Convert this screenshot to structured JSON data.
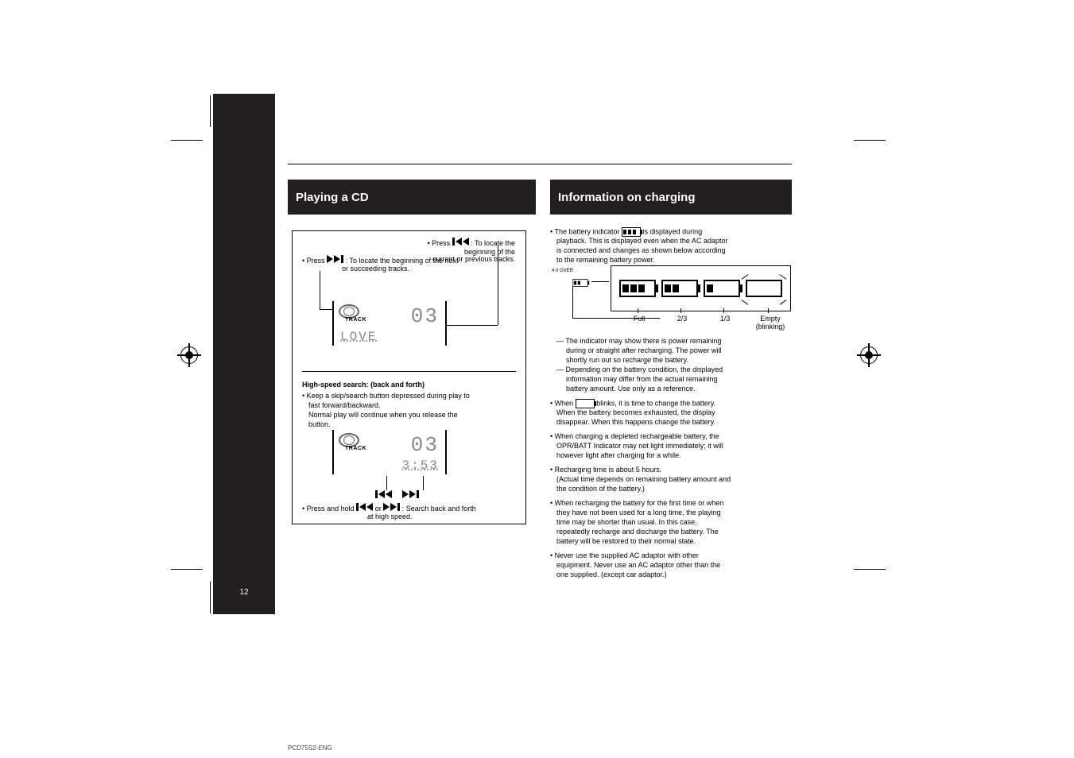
{
  "meta": {
    "page_number": "12",
    "footer_line": "PCD75S2-ENG",
    "track_label": "TRACK",
    "h_over": "4       0 OVER"
  },
  "colors": {
    "gray": [
      "#000000",
      "#1a1a1a",
      "#333333",
      "#4d4d4d",
      "#666666",
      "#808080",
      "#999999",
      "#b3b3b3",
      "#cccccc",
      "#e6e6e6",
      "#ffffff"
    ],
    "cmyk": [
      "#fff200",
      "#ec008c",
      "#00aeef",
      "#2e3192",
      "#ed1c24",
      "#00a651",
      "#231f20",
      "#ffde17",
      "#8dc63f",
      "#6dcff6",
      "#f49ac1"
    ]
  },
  "headings": {
    "left": "Playing a CD",
    "right": "Information on charging"
  },
  "panel": {
    "line1_prefix": "• Press ",
    "line1_suffix": " : To locate the beginning of the next",
    "line1_indent": "or succeeding tracks.",
    "line2_prefix": "• Press ",
    "line2_suffix": " : To locate the beginning of the",
    "line2_indent": "current or previous tracks.",
    "lcd1": {
      "big": "03",
      "sub": "LOVE"
    },
    "sec2_title": "High-speed search: (back and forth)",
    "sec2_l1": "• Keep a skip/search button depressed during play to",
    "sec2_l2": "fast forward/backward.",
    "sec2_l3": "Normal play will continue when you release the",
    "sec2_l4": "button.",
    "lcd2": {
      "big": "03",
      "sub": "3:53"
    },
    "bottom1_prefix": "• Press and hold ",
    "bottom1_mid": " or ",
    "bottom1_suffix": " : Search back and forth",
    "bottom2": "at high speed."
  },
  "right": {
    "intro1_a": "• The battery indicator ",
    "intro1_b": " is displayed during",
    "intro2": "playback. This is displayed even when the AC adaptor",
    "intro3": "is connected and changes as shown below according",
    "intro4": "to the remaining battery power.",
    "cap_full": "Full",
    "cap_23": "2/3",
    "cap_13": "1/3",
    "cap_empty_a": "Empty",
    "cap_empty_b": "(blinking)",
    "under1": "— The indicator may show there is power remaining",
    "under2": "during or straight after recharging. The power will",
    "under3": "shortly run out so recharge the battery.",
    "under4": "— Depending on the battery condition, the displayed",
    "under5": "information may differ from the actual remaining",
    "under6": "battery amount. Use only as a reference.",
    "bullet2a_a": "• When ",
    "bullet2a_b": " blinks, it is time to change the battery.",
    "bullet2b": "When the battery becomes exhausted, the display",
    "bullet2c": "disappear. When this happens change the battery.",
    "bullet3a": "• When charging a depleted rechargeable battery, the",
    "bullet3b": "OPR/BATT Indicator may not light immediately; it will",
    "bullet3c": "however light after charging for a while.",
    "bullet4a": "• Recharging time is about 5 hours.",
    "bullet4b": "(Actual time depends on remaining battery amount and",
    "bullet4c": "the condition of the battery.)",
    "bullet5a": "• When recharging the battery for the first time or when",
    "bullet5b": "they have not been used for a long time, the playing",
    "bullet5c": "time may be shorter than usual. In this case,",
    "bullet5d": "repeatedly recharge and discharge the battery. The",
    "bullet5e": "battery will be restored to their normal state.",
    "bullet6a": "• Never use the supplied AC adaptor with other",
    "bullet6b": "equipment. Never use an AC adaptor other than the",
    "bullet6c": "one supplied. (except car adaptor.)"
  },
  "icons": {
    "next": "next-track-icon",
    "prev": "prev-track-icon",
    "battery": "battery-icon"
  }
}
